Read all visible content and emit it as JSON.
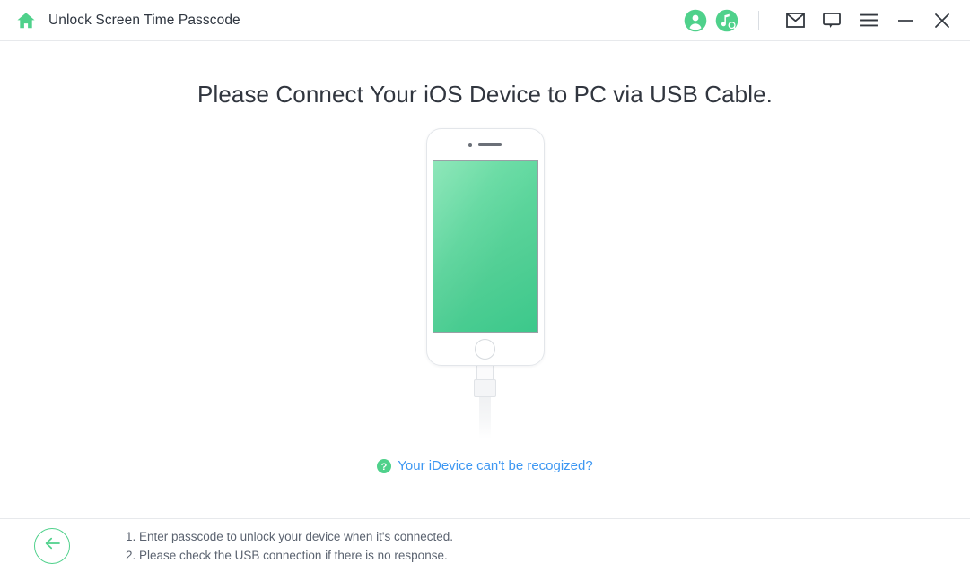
{
  "window": {
    "title": "Unlock Screen Time Passcode",
    "home_icon": "home-icon",
    "account_icon": "account-circle-icon",
    "music_search_icon": "music-search-icon",
    "mail_icon": "mail-envelope-icon",
    "feedback_icon": "speech-bubble-icon",
    "menu_icon": "hamburger-menu-icon",
    "minimize_icon": "minimize-icon",
    "close_icon": "close-icon"
  },
  "main": {
    "headline": "Please Connect Your iOS Device to PC via USB Cable.",
    "device": {
      "name": "ios-device-illustration",
      "camera": "front-camera-dot",
      "speaker": "earpiece-speaker",
      "screen_gradient_from": "#6fe0a6",
      "screen_gradient_to": "#3cc88b",
      "home_button": "device-home-button",
      "cable": "usb-lightning-cable"
    },
    "help_link": {
      "icon": "question-mark-icon",
      "text": "Your iDevice can't be recogized?"
    }
  },
  "footer": {
    "back_icon": "arrow-left-icon",
    "tips": [
      "1. Enter passcode to unlock your device when it's connected.",
      "2. Please check the USB connection if there is no response."
    ]
  },
  "colors": {
    "accent_green": "#4fd18b",
    "link_blue": "#3d97f2",
    "title_text": "#2f3640",
    "body_text": "#5b6370"
  }
}
